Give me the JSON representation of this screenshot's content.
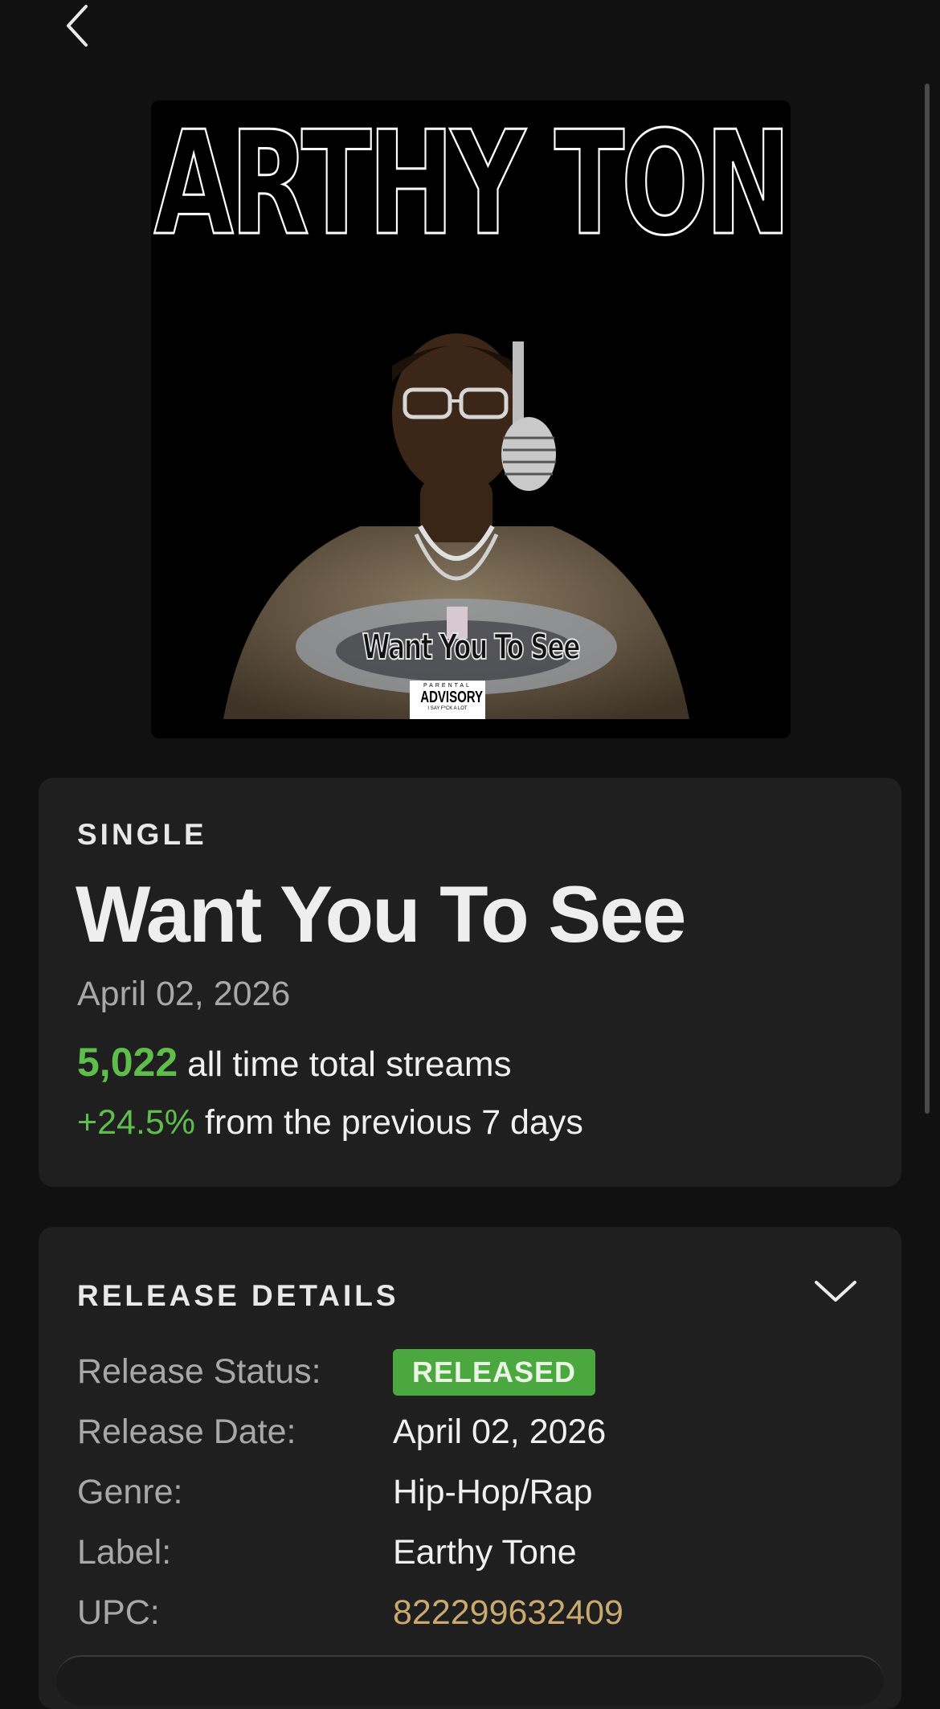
{
  "nav": {
    "back_icon": "chevron-left-icon"
  },
  "cover": {
    "artist_text": "Earthy Tone",
    "song_text": "Want You To See",
    "advisory_top": "PARENTAL",
    "advisory_main": "ADVISORY",
    "advisory_bottom": "I SAY F*CK A LOT"
  },
  "summary": {
    "type": "SINGLE",
    "title": "Want You To See",
    "date": "April 02, 2026",
    "streams_count": "5,022",
    "streams_label": "all time total streams",
    "growth_pct": "+24.5%",
    "growth_label": "from the previous 7 days",
    "accent_color": "#5fbd4c"
  },
  "release_details": {
    "heading": "RELEASE DETAILS",
    "toggle_icon": "chevron-down-icon",
    "rows": [
      {
        "label": "Release Status:",
        "value": "RELEASED"
      },
      {
        "label": "Release Date:",
        "value": "April 02, 2026"
      },
      {
        "label": "Genre:",
        "value": "Hip-Hop/Rap"
      },
      {
        "label": "Label:",
        "value": "Earthy Tone"
      },
      {
        "label": "UPC:",
        "value": "822299632409"
      }
    ]
  }
}
